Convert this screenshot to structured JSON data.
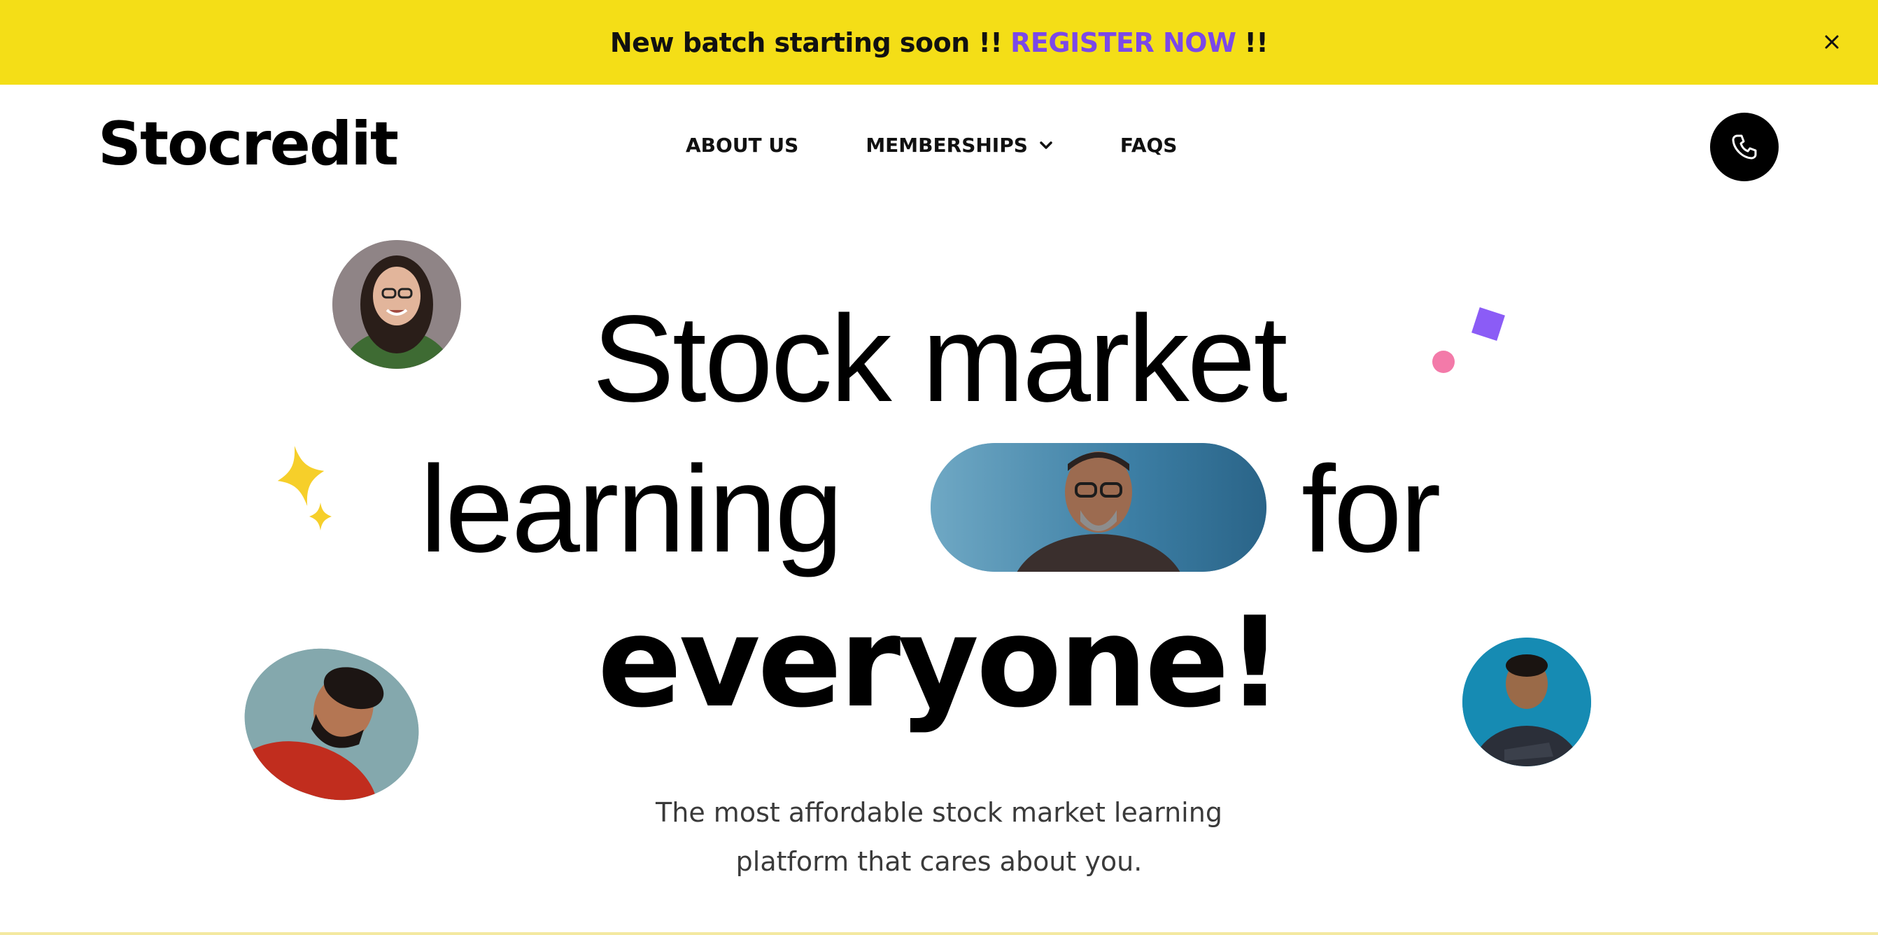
{
  "banner": {
    "text": "New batch starting soon !!",
    "link": "REGISTER NOW",
    "suffix": "!!",
    "close_icon": "close-icon"
  },
  "header": {
    "logo": "Stocredit",
    "nav": {
      "about": "ABOUT US",
      "memberships": "MEMBERSHIPS",
      "faqs": "FAQS"
    },
    "phone_icon": "phone-icon"
  },
  "hero": {
    "line1": "Stock market",
    "line2_left": "learning",
    "line2_right": "for",
    "line3": "everyone!",
    "subtitle_line1": "The most affordable stock market learning",
    "subtitle_line2": "platform that cares about you."
  },
  "colors": {
    "banner_bg": "#f4de17",
    "accent_purple": "#7b48e8",
    "deco_pink": "#f37aa9",
    "deco_yellow": "#f6cf2a"
  }
}
